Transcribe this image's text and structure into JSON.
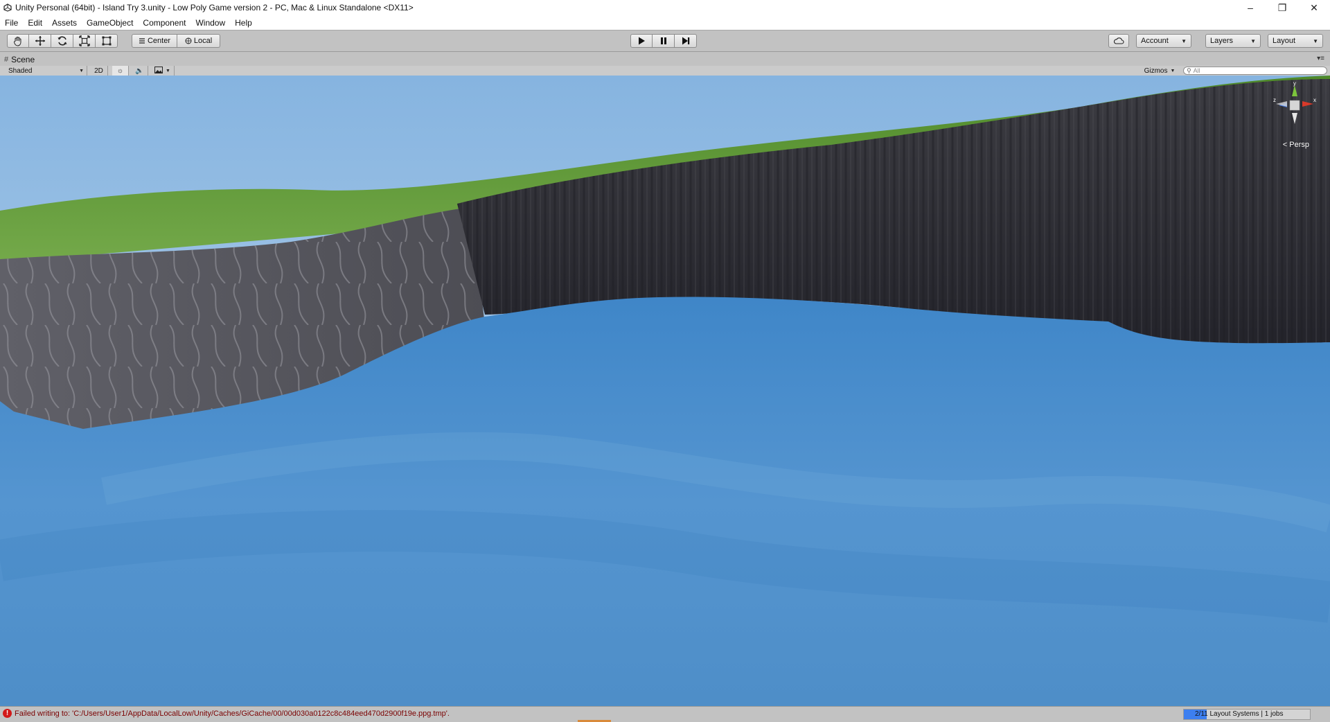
{
  "window": {
    "title": "Unity Personal (64bit) - Island Try 3.unity - Low Poly Game version 2 - PC, Mac & Linux Standalone <DX11>",
    "controls": [
      "minimize",
      "restore",
      "close"
    ]
  },
  "menu": {
    "items": [
      "File",
      "Edit",
      "Assets",
      "GameObject",
      "Component",
      "Window",
      "Help"
    ]
  },
  "toolbar": {
    "transform_tools": [
      "hand-tool",
      "move-tool",
      "rotate-tool",
      "scale-tool",
      "rect-tool"
    ],
    "pivot_mode": "Center",
    "pivot_rotation": "Local",
    "play_controls": [
      "play",
      "pause",
      "step"
    ],
    "account_label": "Account",
    "layers_label": "Layers",
    "layout_label": "Layout"
  },
  "scene_panel": {
    "tab_label": "Scene",
    "draw_mode": "Shaded",
    "mode_2d": "2D",
    "gizmos_label": "Gizmos",
    "search_placeholder": "All",
    "persp_label": "< Persp",
    "gizmo_axes": {
      "y": "y",
      "z": "z",
      "x": "x"
    }
  },
  "status": {
    "message": "Failed writing to: 'C:/Users/User1/AppData/LocalLow/Unity/Caches/GiCache/00/00d030a0122c8c484eed470d2900f19e.ppg.tmp'.",
    "progress_text": "2/11 Layout Systems | 1 jobs",
    "progress_fraction": 0.18
  },
  "colors": {
    "toolbar_bg": "#c2c2c2",
    "sky_top": "#86b4e0",
    "sky_bottom": "#c6dcef",
    "grass": "#5f9a35",
    "cliff": "#4a4a4e",
    "water": "#4f93d0",
    "error": "#d21919",
    "progress": "#3d7ff0"
  }
}
